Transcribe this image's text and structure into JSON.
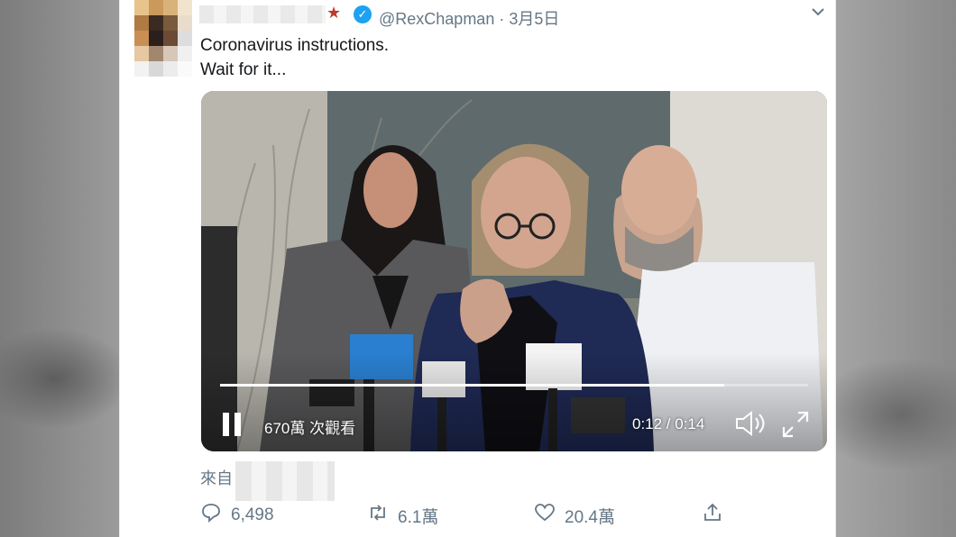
{
  "tweet": {
    "handle": "@RexChapman · 3月5日",
    "text_line1": "Coronavirus instructions.",
    "text_line2": "Wait for it...",
    "source_label": "來自"
  },
  "video": {
    "views": "670萬 次觀看",
    "time": "0:12 / 0:14",
    "progress": 0.857
  },
  "actions": {
    "replies": "6,498",
    "retweets": "6.1萬",
    "likes": "20.4萬"
  },
  "icons": {
    "verified": "verified-badge-icon",
    "menu": "chevron-down-icon",
    "reply": "reply-icon",
    "retweet": "retweet-icon",
    "like": "heart-icon",
    "share": "share-icon",
    "pause": "pause-icon",
    "volume": "volume-icon",
    "fullscreen": "fullscreen-icon"
  },
  "colors": {
    "accent": "#1da1f2",
    "muted": "#657786",
    "text": "#14171a"
  }
}
